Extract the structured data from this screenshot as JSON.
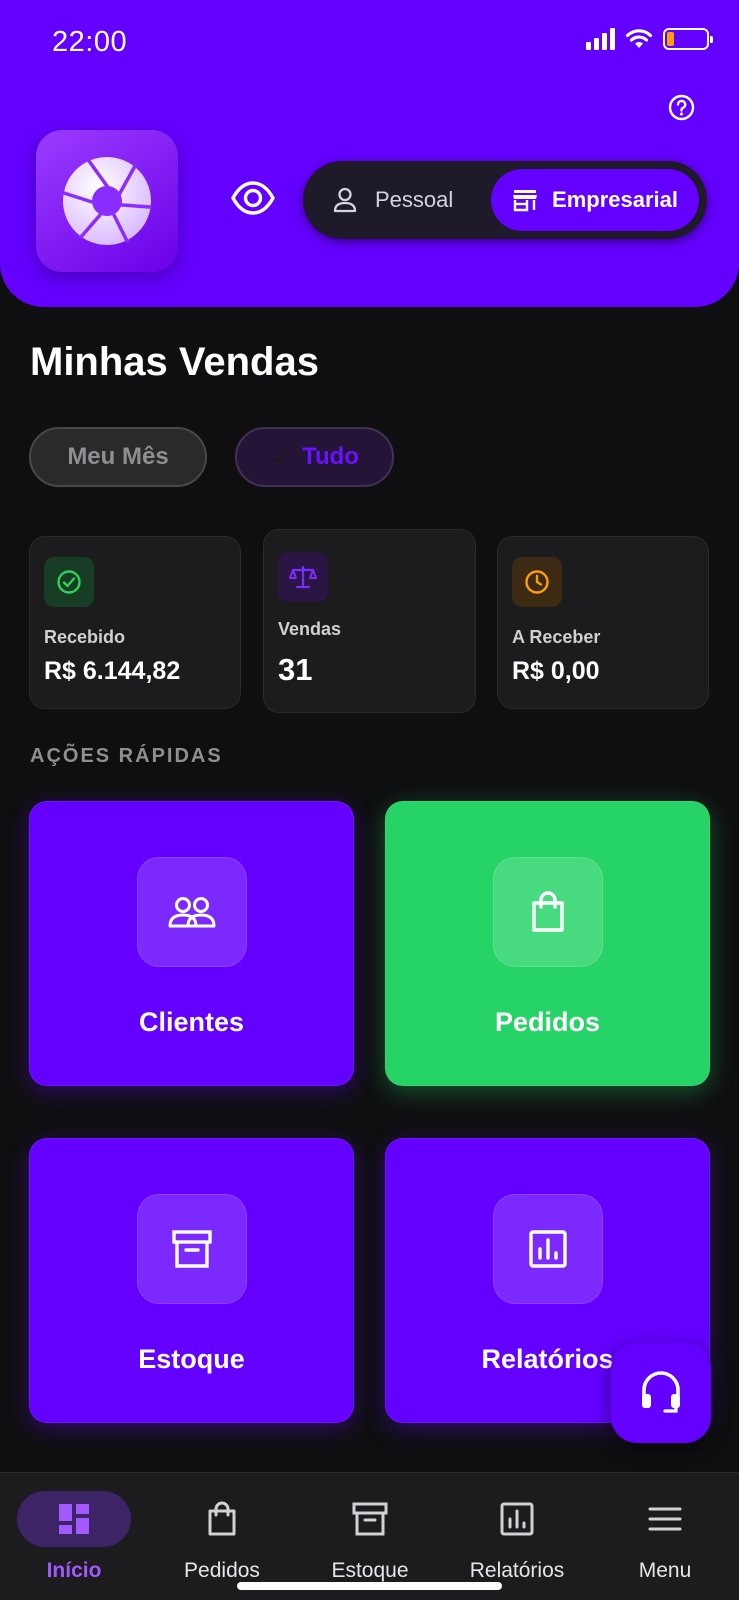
{
  "status_bar": {
    "time": "22:00",
    "battery_color": "#ff9f0a"
  },
  "header": {
    "background": "#6400ff",
    "help_icon": "help-circle-icon",
    "logo_icon": "aperture-icon",
    "visibility_icon": "eye-icon",
    "mode_toggle": {
      "personal_label": "Pessoal",
      "business_label": "Empresarial",
      "selected": "Empresarial"
    }
  },
  "sales": {
    "title": "Minhas Vendas",
    "filters": [
      {
        "label": "Meu Mês",
        "selected": false
      },
      {
        "label": "Tudo",
        "selected": true
      }
    ],
    "stats": [
      {
        "label": "Recebido",
        "value": "R$ 6.144,82",
        "icon": "check-circle-icon",
        "color": "#30d158"
      },
      {
        "label": "Vendas",
        "value": "31",
        "icon": "scale-icon",
        "color": "#7a2bff"
      },
      {
        "label": "A Receber",
        "value": "R$ 0,00",
        "icon": "clock-icon",
        "color": "#ff9f0a"
      }
    ]
  },
  "quick_actions": {
    "title": "AÇÕES RÁPIDAS",
    "items": [
      {
        "label": "Clientes",
        "icon": "users-icon",
        "color": "#6400ff"
      },
      {
        "label": "Pedidos",
        "icon": "shopping-bag-icon",
        "color": "#26d366"
      },
      {
        "label": "Estoque",
        "icon": "archive-box-icon",
        "color": "#6400ff"
      },
      {
        "label": "Relatórios",
        "icon": "bar-chart-icon",
        "color": "#6400ff"
      }
    ]
  },
  "support_button": {
    "icon": "headset-icon"
  },
  "bottom_nav": {
    "items": [
      {
        "label": "Início",
        "icon": "dashboard-icon",
        "active": true
      },
      {
        "label": "Pedidos",
        "icon": "shopping-bag-icon",
        "active": false
      },
      {
        "label": "Estoque",
        "icon": "archive-box-icon",
        "active": false
      },
      {
        "label": "Relatórios",
        "icon": "bar-chart-icon",
        "active": false
      },
      {
        "label": "Menu",
        "icon": "hamburger-menu-icon",
        "active": false
      }
    ]
  }
}
